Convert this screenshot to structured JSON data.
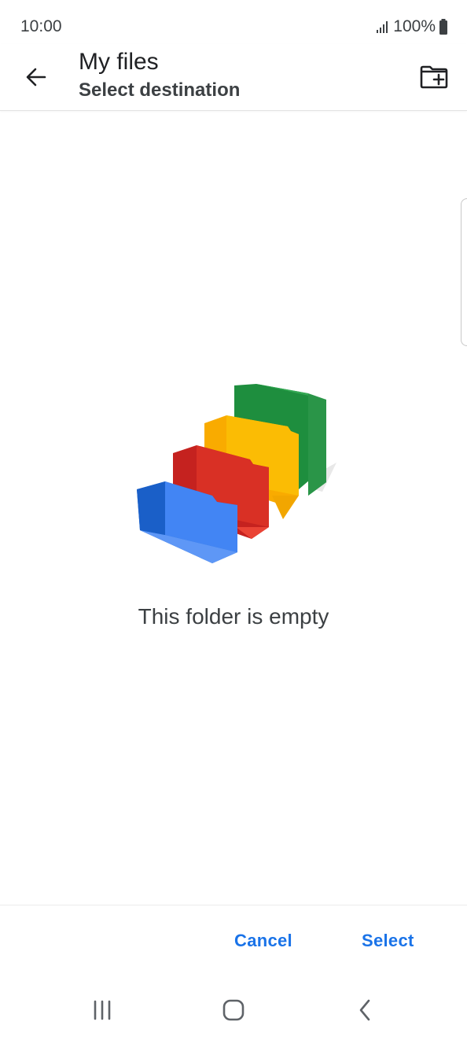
{
  "status_bar": {
    "time": "10:00",
    "battery": "100%",
    "icons": [
      "signal-icon",
      "battery-icon"
    ]
  },
  "app_bar": {
    "back_icon": "arrow-back-icon",
    "title": "My files",
    "subtitle": "Select destination",
    "new_folder_icon": "create-new-folder-icon"
  },
  "empty_state": {
    "illustration": "empty-folders-illustration",
    "message": "This folder is empty"
  },
  "actions": {
    "cancel_label": "Cancel",
    "select_label": "Select"
  },
  "nav_bar": {
    "icons": [
      "recents-icon",
      "home-icon",
      "nav-back-icon"
    ]
  },
  "colors": {
    "accent": "#1a73e8",
    "blue": "#4285f4",
    "red": "#ea4335",
    "yellow": "#fbbc04",
    "green": "#34a853"
  }
}
